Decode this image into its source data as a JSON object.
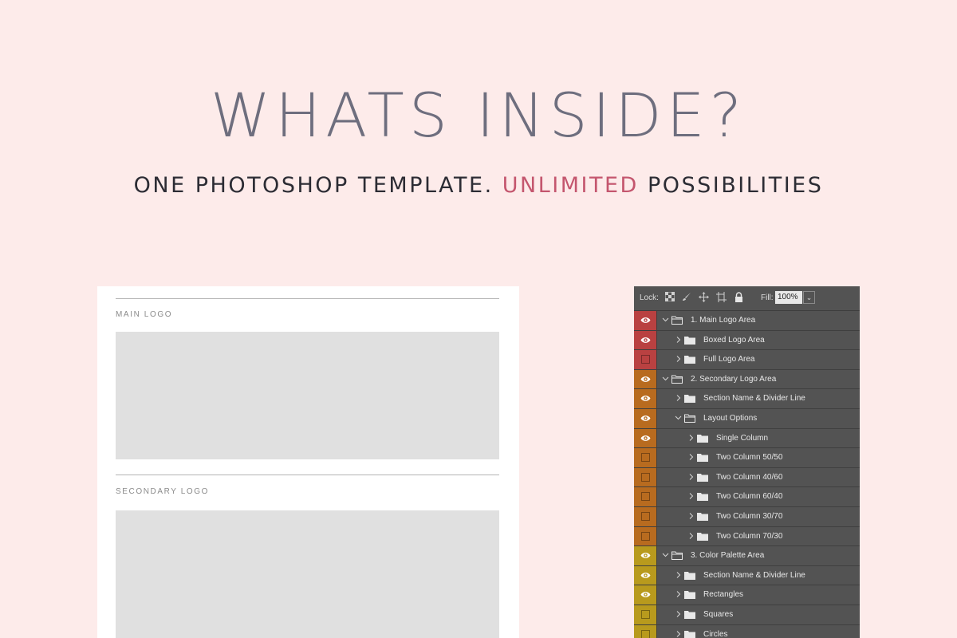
{
  "header": {
    "title": "WHATS INSIDE?",
    "subtitle_before": "ONE PHOTOSHOP TEMPLATE.",
    "subtitle_accent": "UNLIMITED",
    "subtitle_after": "POSSIBILITIES"
  },
  "doc": {
    "main_logo_label": "MAIN LOGO",
    "secondary_logo_label": "SECONDARY LOGO"
  },
  "panel": {
    "lock_label": "Lock:",
    "fill_label": "Fill:",
    "fill_value": "100%",
    "lock_icons": [
      "lock-transparent-icon",
      "lock-brush-icon",
      "lock-move-icon",
      "lock-artboard-icon",
      "lock-all-icon"
    ],
    "colors": {
      "red": "#b94141",
      "orange": "#b86b1f",
      "yellow": "#b89a1d"
    },
    "layers": [
      {
        "name": "1. Main Logo Area",
        "color": "red",
        "visible": true,
        "expanded": true,
        "depth": 0
      },
      {
        "name": "Boxed Logo Area",
        "color": "red",
        "visible": true,
        "expanded": false,
        "depth": 1
      },
      {
        "name": "Full Logo Area",
        "color": "red",
        "visible": false,
        "expanded": false,
        "depth": 1
      },
      {
        "name": "2. Secondary Logo Area",
        "color": "orange",
        "visible": true,
        "expanded": true,
        "depth": 0
      },
      {
        "name": "Section Name & Divider Line",
        "color": "orange",
        "visible": true,
        "expanded": false,
        "depth": 1
      },
      {
        "name": "Layout Options",
        "color": "orange",
        "visible": true,
        "expanded": true,
        "depth": 1
      },
      {
        "name": "Single Column",
        "color": "orange",
        "visible": true,
        "expanded": false,
        "depth": 2
      },
      {
        "name": "Two Column 50/50",
        "color": "orange",
        "visible": false,
        "expanded": false,
        "depth": 2
      },
      {
        "name": "Two Column 40/60",
        "color": "orange",
        "visible": false,
        "expanded": false,
        "depth": 2
      },
      {
        "name": "Two Column 60/40",
        "color": "orange",
        "visible": false,
        "expanded": false,
        "depth": 2
      },
      {
        "name": "Two Column 30/70",
        "color": "orange",
        "visible": false,
        "expanded": false,
        "depth": 2
      },
      {
        "name": "Two Column 70/30",
        "color": "orange",
        "visible": false,
        "expanded": false,
        "depth": 2
      },
      {
        "name": "3. Color Palette Area",
        "color": "yellow",
        "visible": true,
        "expanded": true,
        "depth": 0
      },
      {
        "name": "Section Name & Divider Line",
        "color": "yellow",
        "visible": true,
        "expanded": false,
        "depth": 1
      },
      {
        "name": "Rectangles",
        "color": "yellow",
        "visible": true,
        "expanded": false,
        "depth": 1
      },
      {
        "name": "Squares",
        "color": "yellow",
        "visible": false,
        "expanded": false,
        "depth": 1
      },
      {
        "name": "Circles",
        "color": "yellow",
        "visible": false,
        "expanded": false,
        "depth": 1
      }
    ]
  }
}
